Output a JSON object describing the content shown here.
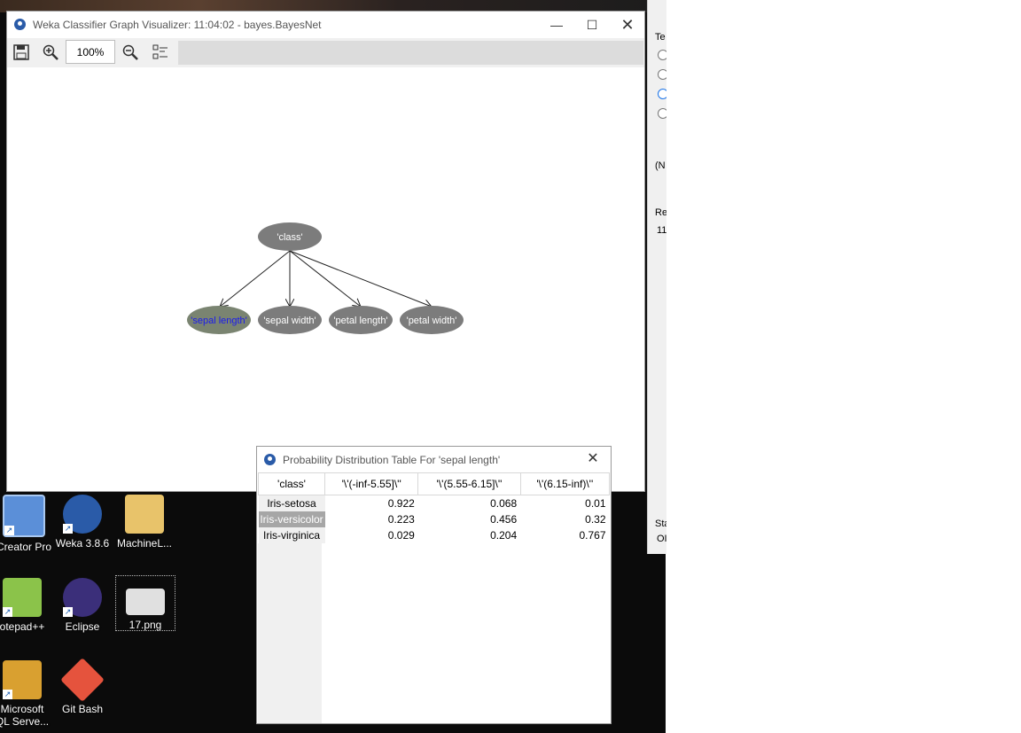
{
  "graph_window": {
    "title": "Weka Classifier Graph Visualizer: 11:04:02 - bayes.BayesNet",
    "zoom": "100%",
    "nodes": {
      "class": "'class'",
      "sepal_length": "'sepal length'",
      "sepal_width": "'sepal width'",
      "petal_length": "'petal length'",
      "petal_width": "'petal width'"
    },
    "selected_node_color": "#7a8471",
    "node_color": "#7c7c7c"
  },
  "prob_window": {
    "title": "Probability Distribution Table For 'sepal length'",
    "headers": [
      "'class'",
      "'\\'(-inf-5.55]\\''",
      "'\\'(5.55-6.15]\\''",
      "'\\'(6.15-inf)\\''"
    ],
    "rows": [
      {
        "label": "Iris-setosa",
        "values": [
          "0.922",
          "0.068",
          "0.01"
        ]
      },
      {
        "label": "Iris-versicolor",
        "values": [
          "0.223",
          "0.456",
          "0.32"
        ]
      },
      {
        "label": "Iris-virginica",
        "values": [
          "0.029",
          "0.204",
          "0.767"
        ]
      }
    ]
  },
  "desktop": {
    "icons": [
      {
        "label": "Creator Pro"
      },
      {
        "label": "Weka 3.8.6"
      },
      {
        "label": "MachineL..."
      },
      {
        "label": "otepad++"
      },
      {
        "label": "Eclipse"
      },
      {
        "label": "17.png"
      },
      {
        "label": "Microsoft"
      },
      {
        "label": "QL Serve..."
      },
      {
        "label": "Git Bash"
      }
    ]
  },
  "back_window": {
    "fragments": [
      "Te",
      "(N",
      "Re",
      "11",
      "Sta",
      "OI"
    ]
  }
}
